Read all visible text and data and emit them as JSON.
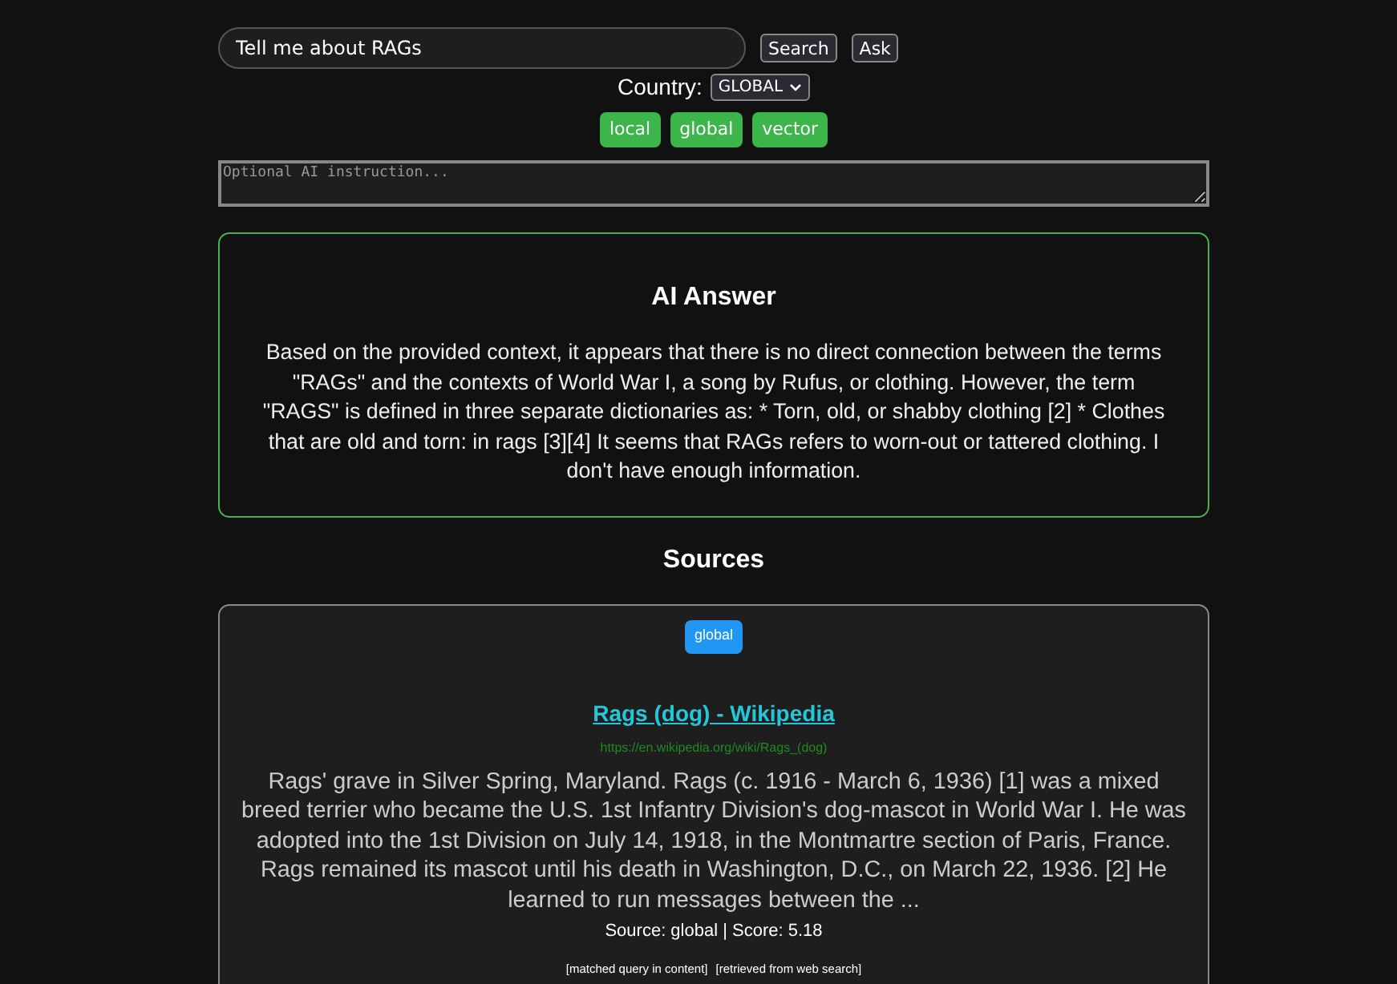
{
  "search": {
    "value": "Tell me about RAGs",
    "buttons": [
      "Search",
      "Ask"
    ]
  },
  "country": {
    "label": "Country:",
    "value": "GLOBAL"
  },
  "modes": [
    "local",
    "global",
    "vector"
  ],
  "instruction": {
    "placeholder": "Optional AI instruction..."
  },
  "answer": {
    "title": "AI Answer",
    "text": "Based on the provided context, it appears that there is no direct connection between the terms \"RAGs\" and the contexts of World War I, a song by Rufus, or clothing. However, the term \"RAGS\" is defined in three separate dictionaries as: * Torn, old, or shabby clothing [2] * Clothes that are old and torn: in rags [3][4] It seems that RAGs refers to worn-out or tattered clothing. I don't have enough information."
  },
  "sources_title": "Sources",
  "sources": [
    {
      "badge": "global",
      "title": "Rags (dog) - Wikipedia",
      "url": "https://en.wikipedia.org/wiki/Rags_(dog)",
      "snippet": "Rags' grave in Silver Spring, Maryland. Rags (c. 1916 - March 6, 1936) [1] was a mixed breed terrier who became the U.S. 1st Infantry Division's dog-mascot in World War I. He was adopted into the 1st Division on July 14, 1918, in the Montmartre section of Paris, France. Rags remained its mascot until his death in Washington, D.C., on March 22, 1936. [2] He learned to run messages between the ...",
      "meta": "Source: global | Score: 5.18",
      "tags": [
        "[matched query in content]",
        "[retrieved from web search]"
      ]
    }
  ]
}
